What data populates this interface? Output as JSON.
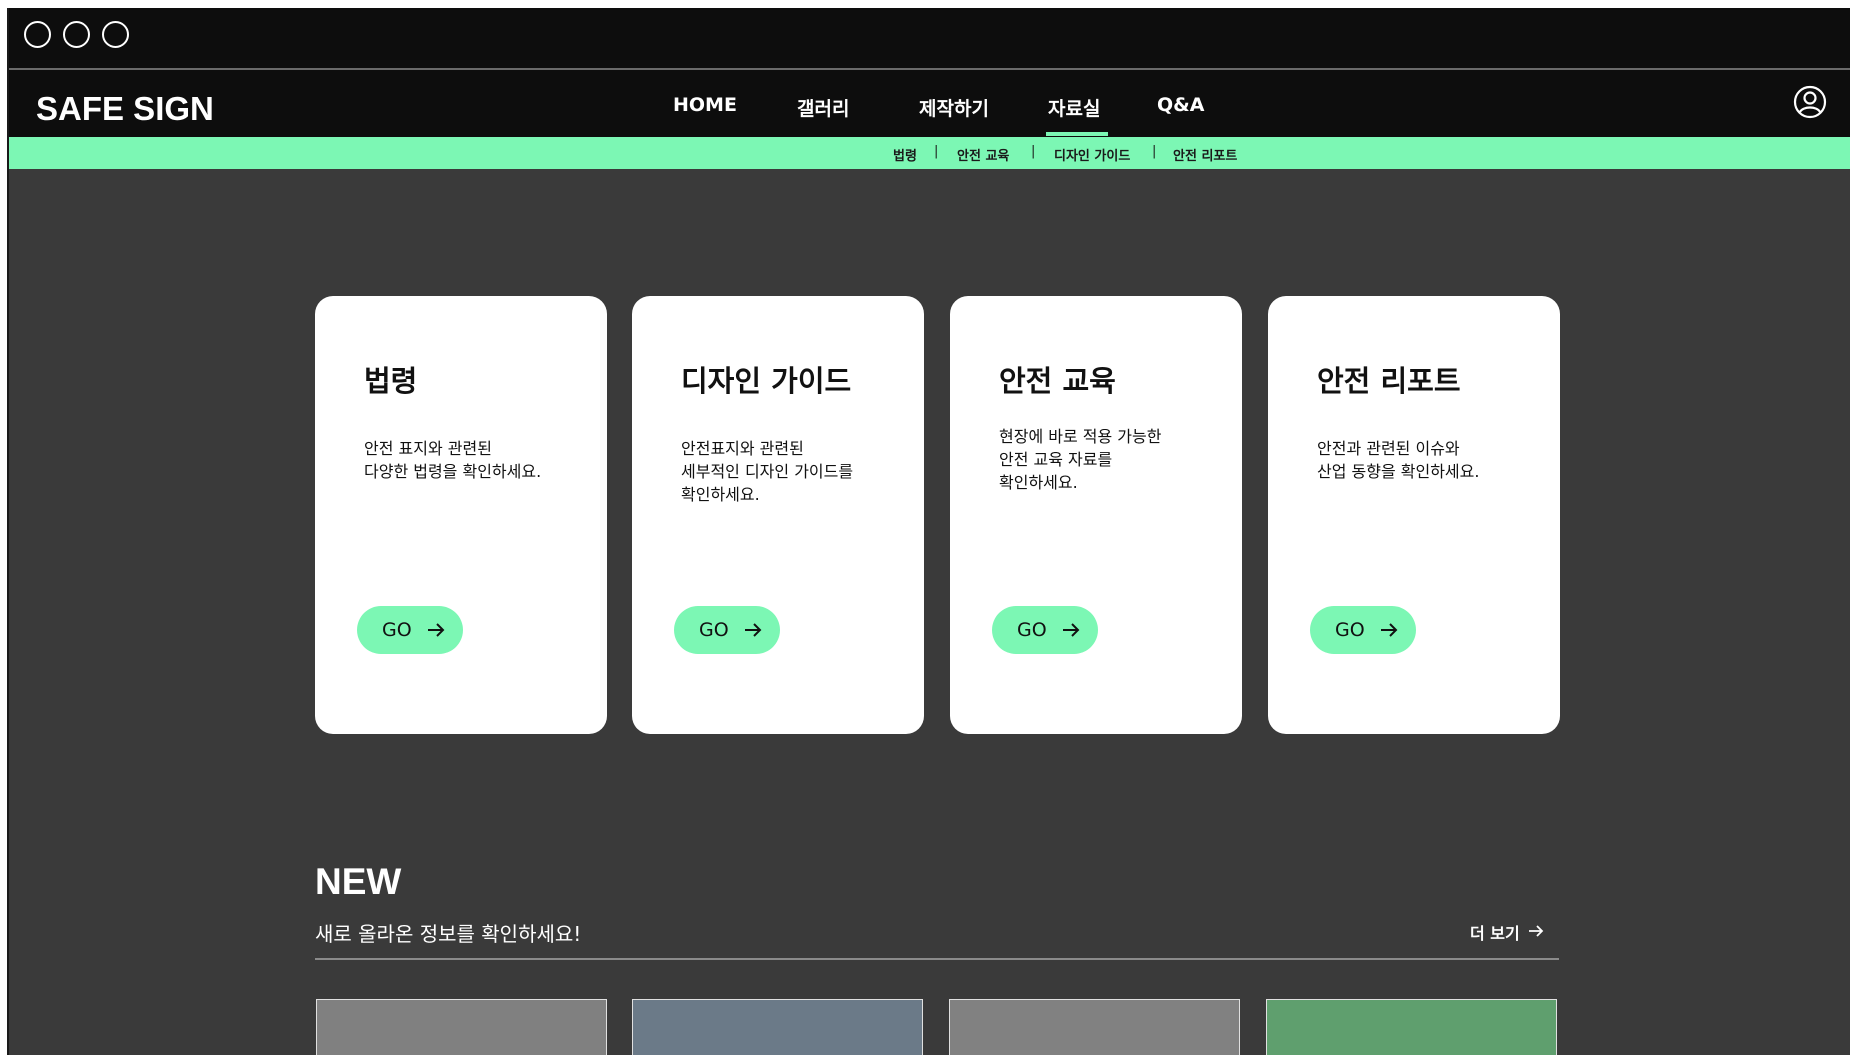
{
  "window": {
    "controls": [
      "close",
      "minimize",
      "maximize"
    ]
  },
  "header": {
    "logo": "SAFE SIGN",
    "nav": [
      "HOME",
      "갤러리",
      "제작하기",
      "자료실",
      "Q&A"
    ],
    "active_nav": "자료실",
    "user_icon": "user-circle-icon"
  },
  "subnav": {
    "items": [
      "법령",
      "안전 교육",
      "디자인 가이드",
      "안전 리포트"
    ],
    "separator": "|"
  },
  "cards": [
    {
      "title": "법령",
      "desc": "안전 표지와 관련된\n다양한 법령을 확인하세요.",
      "button": "GO"
    },
    {
      "title": "디자인 가이드",
      "desc": "안전표지와 관련된\n세부적인 디자인 가이드를\n확인하세요.",
      "button": "GO"
    },
    {
      "title": "안전 교육",
      "desc": "현장에 바로 적용 가능한\n안전 교육 자료를\n확인하세요.",
      "button": "GO"
    },
    {
      "title": "안전 리포트",
      "desc": "안전과 관련된 이슈와\n산업 동향을 확인하세요.",
      "button": "GO"
    }
  ],
  "new_section": {
    "title": "NEW",
    "subtitle": "새로 올라온 정보를 확인하세요!",
    "more": "더 보기",
    "thumbnail_colors": [
      "#808080",
      "#6b7a88",
      "#818181",
      "#5f9f6e"
    ]
  },
  "colors": {
    "accent": "#7cf7b4",
    "background": "#3a3a3a",
    "bar": "#0d0d0d"
  }
}
